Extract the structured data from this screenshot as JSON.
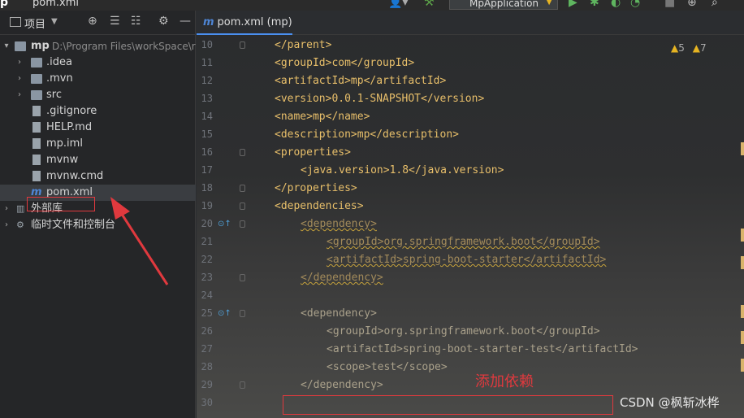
{
  "topbar": {
    "logo": "p",
    "file_name": "pom.xml",
    "run_config": "MpApplication"
  },
  "project_panel": {
    "title": "项目",
    "root": {
      "name": "mp",
      "path": "D:\\Program Files\\workSpace\\r"
    },
    "items": [
      {
        "label": ".idea",
        "type": "folder"
      },
      {
        "label": ".mvn",
        "type": "folder"
      },
      {
        "label": "src",
        "type": "folder"
      },
      {
        "label": ".gitignore",
        "type": "file"
      },
      {
        "label": "HELP.md",
        "type": "file"
      },
      {
        "label": "mp.iml",
        "type": "file"
      },
      {
        "label": "mvnw",
        "type": "file"
      },
      {
        "label": "mvnw.cmd",
        "type": "file"
      },
      {
        "label": "pom.xml",
        "type": "maven"
      }
    ],
    "external_libs": "外部库",
    "scratches": "临时文件和控制台"
  },
  "editor": {
    "tab_label": "pom.xml (mp)",
    "warnings": {
      "count_a": "5",
      "count_b": "7"
    },
    "lines": [
      {
        "no": "10",
        "text": "</parent>"
      },
      {
        "no": "11",
        "text": "<groupId>com</groupId>"
      },
      {
        "no": "12",
        "text": "<artifactId>mp</artifactId>"
      },
      {
        "no": "13",
        "text": "<version>0.0.1-SNAPSHOT</version>"
      },
      {
        "no": "14",
        "text": "<name>mp</name>"
      },
      {
        "no": "15",
        "text": "<description>mp</description>"
      },
      {
        "no": "16",
        "text": "<properties>"
      },
      {
        "no": "17",
        "text": "<java.version>1.8</java.version>"
      },
      {
        "no": "18",
        "text": "</properties>"
      },
      {
        "no": "19",
        "text": "<dependencies>"
      },
      {
        "no": "20",
        "text": "<dependency>"
      },
      {
        "no": "21",
        "text": "<groupId>org.springframework.boot</groupId>"
      },
      {
        "no": "22",
        "text": "<artifactId>spring-boot-starter</artifactId>"
      },
      {
        "no": "23",
        "text": "</dependency>"
      },
      {
        "no": "24",
        "text": ""
      },
      {
        "no": "25",
        "text": "<dependency>"
      },
      {
        "no": "26",
        "text": "<groupId>org.springframework.boot</groupId>"
      },
      {
        "no": "27",
        "text": "<artifactId>spring-boot-starter-test</artifactId>"
      },
      {
        "no": "28",
        "text": "<scope>test</scope>"
      },
      {
        "no": "29",
        "text": "</dependency>"
      },
      {
        "no": "30",
        "text": ""
      }
    ]
  },
  "annotation": {
    "add_label": "添加依赖",
    "watermark": "CSDN @枫斩冰桦"
  }
}
